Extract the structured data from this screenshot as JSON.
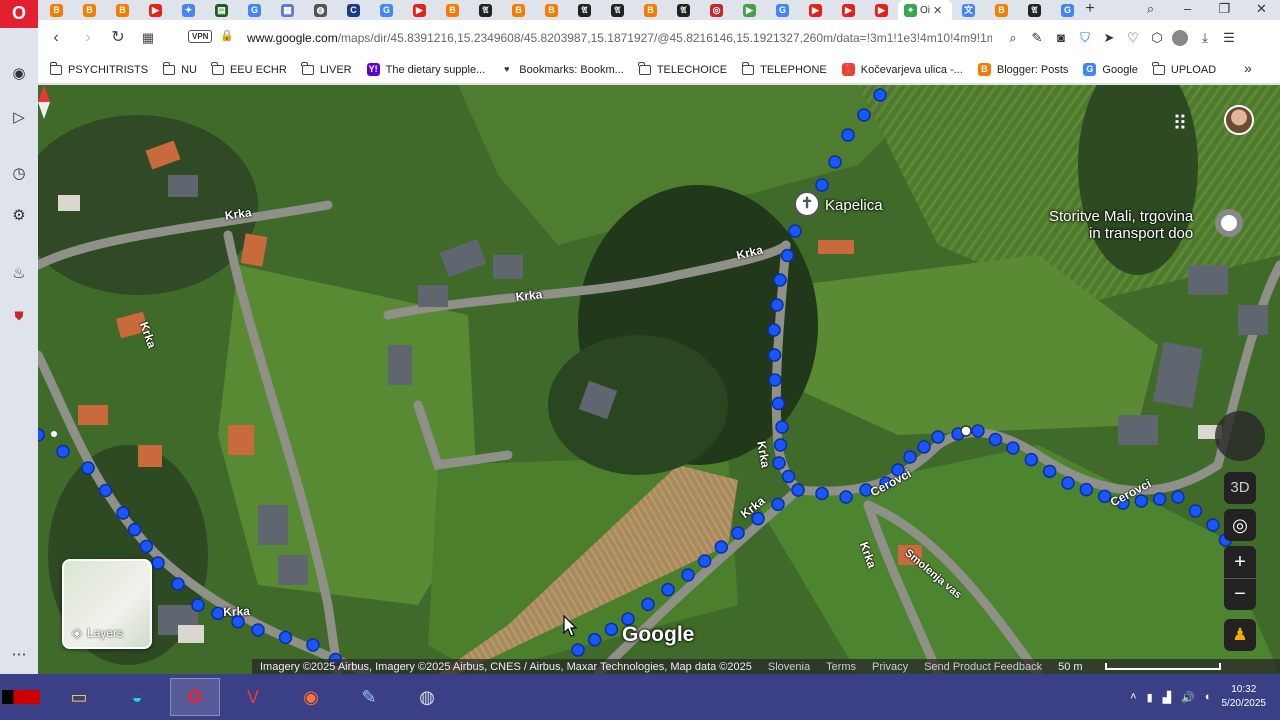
{
  "tabs": {
    "items": [
      {
        "icon": "blogger-icon",
        "color": "#f57c00",
        "glyph": "B"
      },
      {
        "icon": "blogger-icon",
        "color": "#f57c00",
        "glyph": "B"
      },
      {
        "icon": "blogger-icon",
        "color": "#f57c00",
        "glyph": "B"
      },
      {
        "icon": "youtube-icon",
        "color": "#e62117",
        "glyph": "▶"
      },
      {
        "icon": "pinwheel-icon",
        "color": "#4285f4",
        "glyph": "✦"
      },
      {
        "icon": "flag-icon",
        "color": "#1b5e20",
        "glyph": "▤"
      },
      {
        "icon": "google-icon",
        "color": "#4285f4",
        "glyph": "G"
      },
      {
        "icon": "apps-icon",
        "color": "#5b7bd5",
        "glyph": "▦"
      },
      {
        "icon": "globe-icon",
        "color": "#555555",
        "glyph": "◍"
      },
      {
        "icon": "shield-c-icon",
        "color": "#1e3a8a",
        "glyph": "C"
      },
      {
        "icon": "google-icon",
        "color": "#4285f4",
        "glyph": "G"
      },
      {
        "icon": "youtube-icon",
        "color": "#e62117",
        "glyph": "▶"
      },
      {
        "icon": "blogger-icon",
        "color": "#f57c00",
        "glyph": "B"
      },
      {
        "icon": "nyt-icon",
        "color": "#222222",
        "glyph": "𝔄"
      },
      {
        "icon": "blogger-icon",
        "color": "#f57c00",
        "glyph": "B"
      },
      {
        "icon": "blogger-icon",
        "color": "#f57c00",
        "glyph": "B"
      },
      {
        "icon": "nyt-icon",
        "color": "#222222",
        "glyph": "𝔄"
      },
      {
        "icon": "nyt-icon",
        "color": "#222222",
        "glyph": "𝔄"
      },
      {
        "icon": "blogger-icon",
        "color": "#f57c00",
        "glyph": "B"
      },
      {
        "icon": "nyt-icon",
        "color": "#222222",
        "glyph": "𝔄"
      },
      {
        "icon": "oracle-icon",
        "color": "#c62828",
        "glyph": "◎"
      },
      {
        "icon": "play-icon",
        "color": "#43a047",
        "glyph": "▶"
      },
      {
        "icon": "google-icon",
        "color": "#4285f4",
        "glyph": "G"
      },
      {
        "icon": "youtube-icon",
        "color": "#e62117",
        "glyph": "▶"
      },
      {
        "icon": "youtube-icon",
        "color": "#e62117",
        "glyph": "▶"
      },
      {
        "icon": "youtube-icon",
        "color": "#e62117",
        "glyph": "▶"
      }
    ],
    "active": {
      "title": "Oi",
      "icon": "google-maps-icon"
    },
    "after": [
      {
        "icon": "translate-icon",
        "color": "#4285f4",
        "glyph": "文"
      },
      {
        "icon": "blogger-icon",
        "color": "#f57c00",
        "glyph": "B"
      },
      {
        "icon": "nyt-icon",
        "color": "#222222",
        "glyph": "𝔄"
      },
      {
        "icon": "google-icon",
        "color": "#4285f4",
        "glyph": "G"
      }
    ]
  },
  "address": {
    "vpn_label": "VPN",
    "url_host": "www.google.com",
    "url_path": "/maps/dir/45.8391216,15.2349608/45.8203987,15.1871927/@45.8216146,15.1921327,260m/data=!3m1!1e3!4m10!4m9!1m"
  },
  "bookmarks": [
    {
      "label": "PSYCHITRISTS",
      "icon": "folder-icon"
    },
    {
      "label": "NU",
      "icon": "folder-icon"
    },
    {
      "label": "EEU ECHR",
      "icon": "folder-icon"
    },
    {
      "label": "LIVER",
      "icon": "folder-icon"
    },
    {
      "label": "The dietary supple...",
      "icon": "yahoo-icon"
    },
    {
      "label": "Bookmarks: Bookm...",
      "icon": "heart-icon"
    },
    {
      "label": "TELECHOICE",
      "icon": "folder-icon"
    },
    {
      "label": "TELEPHONE",
      "icon": "folder-icon"
    },
    {
      "label": "Kočevarjeva ulica -...",
      "icon": "maps-pin-icon"
    },
    {
      "label": "Blogger: Posts",
      "icon": "blogger-icon"
    },
    {
      "label": "Google",
      "icon": "google-icon"
    },
    {
      "label": "UPLOAD",
      "icon": "folder-icon"
    }
  ],
  "map": {
    "road_labels": [
      "Krka",
      "Krka",
      "Krka",
      "Krka",
      "Krka",
      "Krka",
      "Krka",
      "Cerovci",
      "Cerovci",
      "Krka",
      "Smolenja vas"
    ],
    "places": {
      "kapelica": "Kapelica",
      "shop_line1": "Storitve Mali, trgovina",
      "shop_line2": "in transport doo"
    },
    "layers_label": "Layers",
    "google_logo": "Google",
    "btn_3d": "3D",
    "footer": {
      "attribution": "Imagery ©2025 Airbus, Imagery ©2025 Airbus, CNES / Airbus, Maxar Technologies, Map data ©2025",
      "region": "Slovenia",
      "terms": "Terms",
      "privacy": "Privacy",
      "feedback": "Send Product Feedback",
      "scale": "50 m"
    },
    "route_color": "#1a56ff"
  },
  "taskbar": {
    "time": "10:32",
    "date": "5/20/2025"
  }
}
